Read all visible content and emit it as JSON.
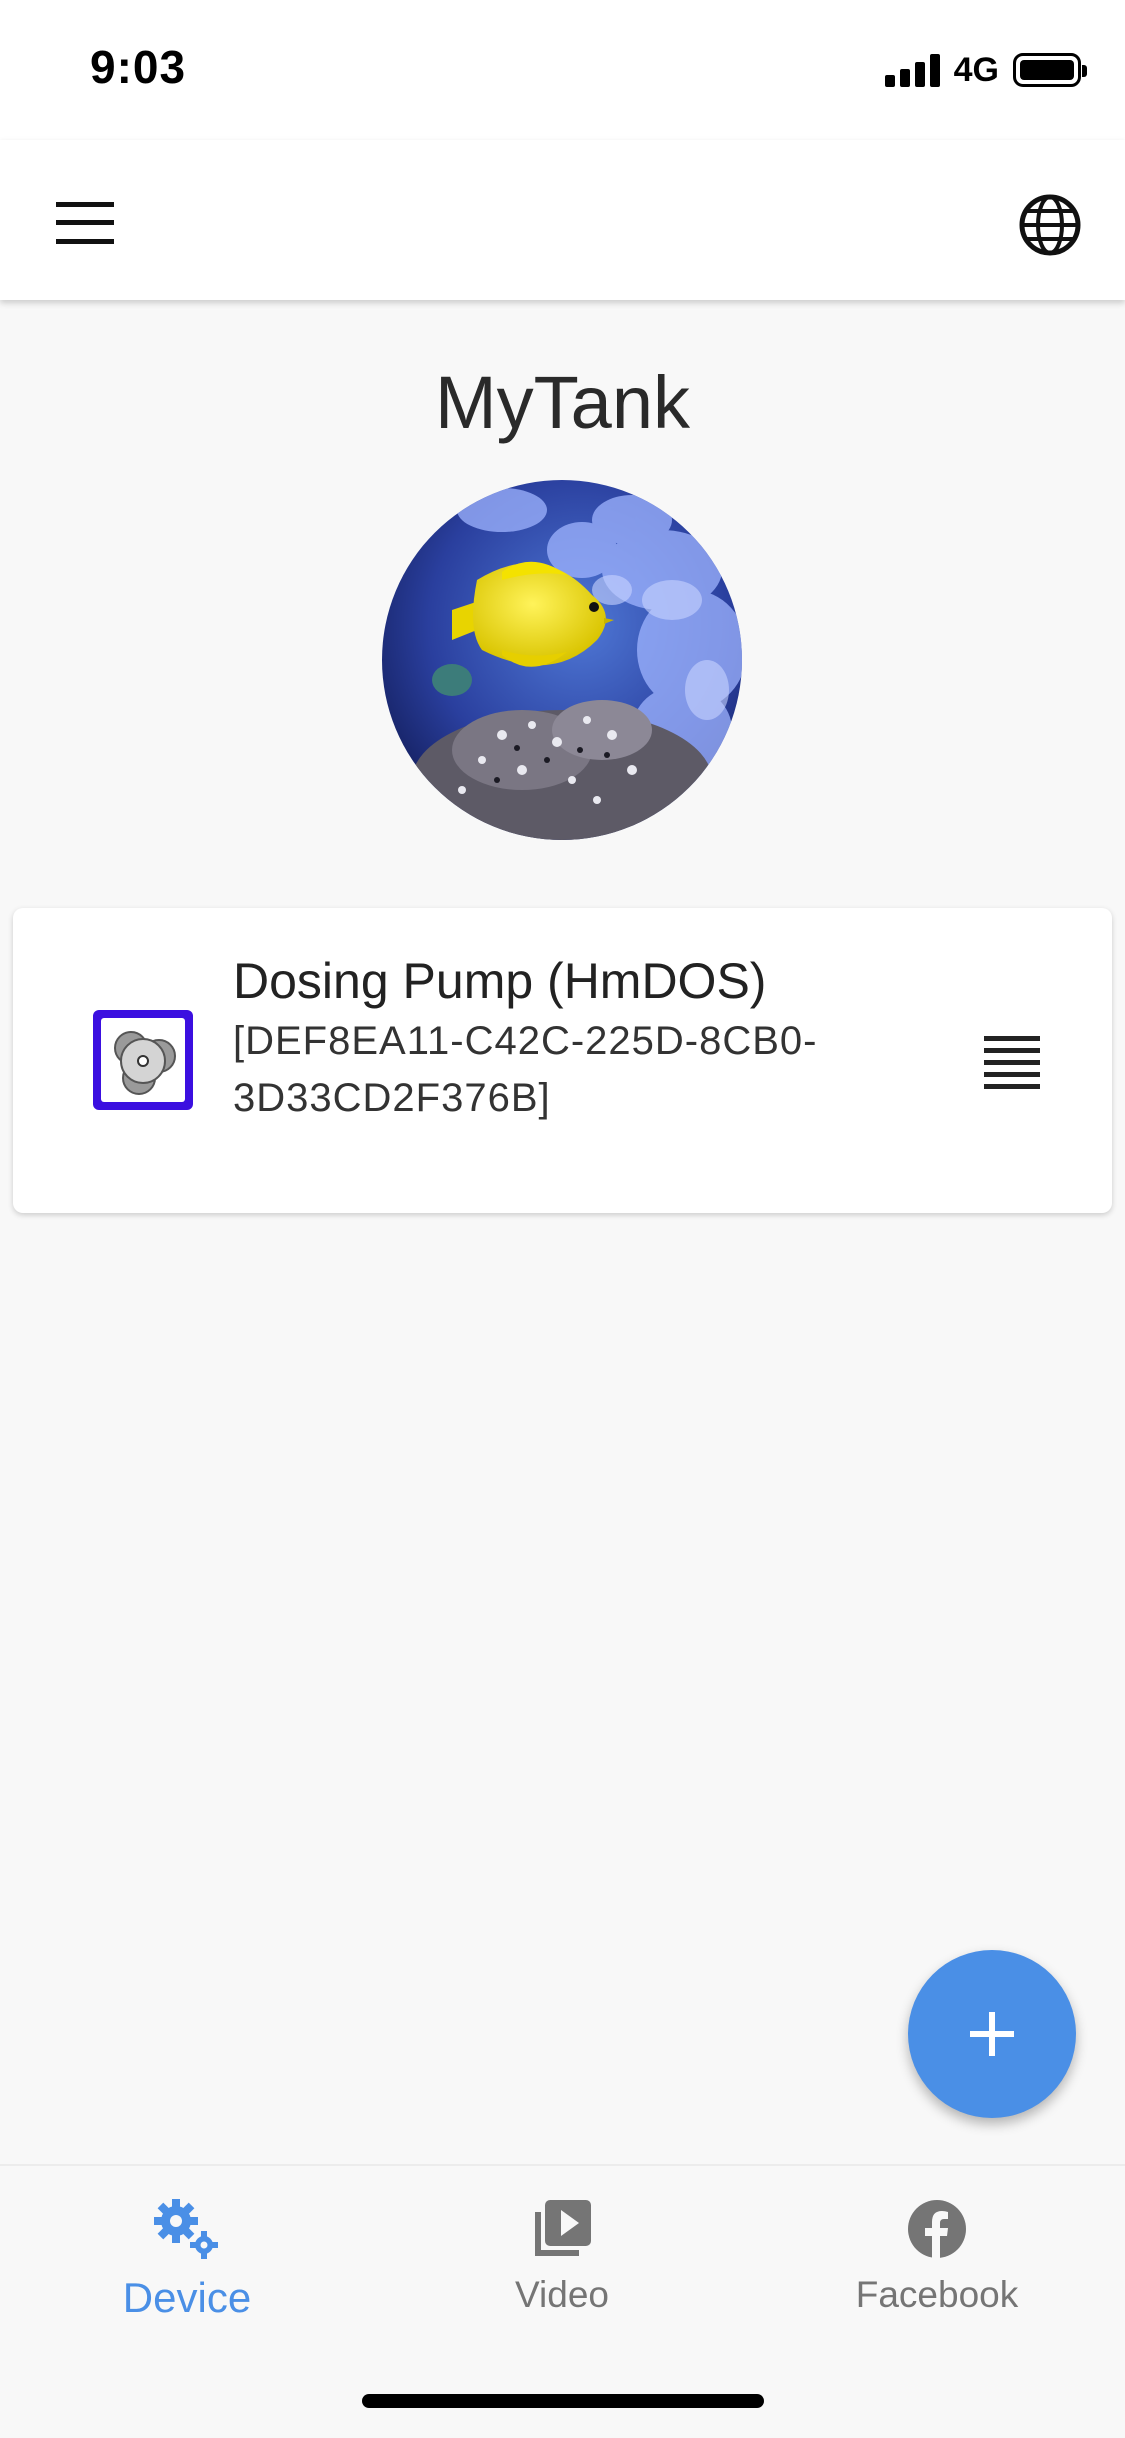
{
  "status_bar": {
    "time": "9:03",
    "network": "4G"
  },
  "app_bar": {
    "menu_icon": "hamburger-menu-icon",
    "language_icon": "globe-icon"
  },
  "tank": {
    "title": "MyTank",
    "photo_icon": "tank-photo"
  },
  "devices": [
    {
      "name": "Dosing Pump (HmDOS)",
      "id": "[DEF8EA11-C42C-225D-8CB0-3D33CD2F376B]",
      "icon": "dosing-pump-icon",
      "menu_icon": "reorder-icon"
    }
  ],
  "fab": {
    "icon": "plus-icon"
  },
  "bottom_nav": {
    "tabs": [
      {
        "label": "Device",
        "icon": "gears-icon",
        "active": true
      },
      {
        "label": "Video",
        "icon": "video-library-icon",
        "active": false
      },
      {
        "label": "Facebook",
        "icon": "facebook-icon",
        "active": false
      }
    ]
  },
  "colors": {
    "accent": "#4a8fe6",
    "device_icon_border": "#3b0fe0",
    "background": "#f8f8f8",
    "inactive_tab": "#757575"
  }
}
